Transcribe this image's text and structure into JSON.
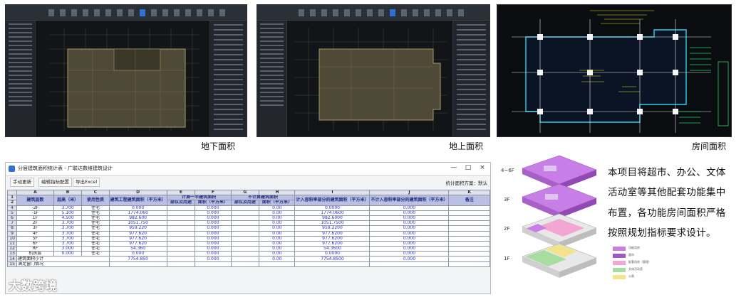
{
  "captions": {
    "basement": "地下面积",
    "above_ground": "地上面积",
    "room": "房间面积"
  },
  "window": {
    "title": "分层建筑面积统计表 - 广联达数维建筑设计",
    "minimize": "—",
    "maximize": "□",
    "close": "×"
  },
  "toolbar": {
    "manual_update": "手动更新",
    "edit_indicators": "编辑指标配置",
    "export_excel": "导出Excel",
    "right_text": "统计面积方案：默认"
  },
  "table": {
    "col_letters": [
      "A",
      "B",
      "C",
      "D",
      "E",
      "F",
      "G",
      "H",
      "I",
      "J",
      "K"
    ],
    "header_row1": {
      "floor": "建筑层数",
      "height": "层高（米）",
      "use": "使用性质",
      "total_area": "建筑工程建筑面积（平方米）",
      "full_calc": "计算一半建筑面积",
      "no_calc": "不计算建筑面积",
      "volume_area": "计入容积率部分的建筑面积（平方米）",
      "non_volume_area": "不计入容积率部分的建筑面积（平方米）",
      "note": "备注"
    },
    "header_row2": {
      "e": "部位及用途",
      "f": "面积（平方米）",
      "g": "部位及用途",
      "h": "面积（平方米）"
    },
    "rows": [
      {
        "n": "4",
        "floor": "-2F",
        "height": "3.700",
        "use": "住宅",
        "d": "0.000",
        "f": "0.000",
        "h": "0.00",
        "i": "0.0000",
        "j": "0.000"
      },
      {
        "n": "5",
        "floor": "-1F",
        "height": "5.100",
        "use": "住宅",
        "d": "1774.060",
        "f": "0.000",
        "h": "0.00",
        "i": "1774.0600",
        "j": "0.000"
      },
      {
        "n": "6",
        "floor": "1F",
        "height": "4.500",
        "use": "住宅",
        "d": "982.600",
        "f": "0.000",
        "h": "0.00",
        "i": "982.6000",
        "j": "0.000"
      },
      {
        "n": "7",
        "floor": "2F",
        "height": "3.700",
        "use": "住宅",
        "d": "1051.750",
        "f": "0.000",
        "h": "0.00",
        "i": "1051.7500",
        "j": "0.000"
      },
      {
        "n": "8",
        "floor": "3F",
        "height": "3.700",
        "use": "住宅",
        "d": "959.220",
        "f": "0.000",
        "h": "0.00",
        "i": "959.2200",
        "j": "0.000"
      },
      {
        "n": "9",
        "floor": "4F",
        "height": "3.700",
        "use": "住宅",
        "d": "977.620",
        "f": "0.000",
        "h": "0.00",
        "i": "977.6200",
        "j": "0.000"
      },
      {
        "n": "10",
        "floor": "5F",
        "height": "3.700",
        "use": "住宅",
        "d": "977.620",
        "f": "0.000",
        "h": "0.00",
        "i": "977.6200",
        "j": "0.000"
      },
      {
        "n": "11",
        "floor": "6F",
        "height": "3.700",
        "use": "住宅",
        "d": "977.620",
        "f": "0.000",
        "h": "0.00",
        "i": "977.6200",
        "j": "0.000"
      },
      {
        "n": "12",
        "floor": "RF",
        "height": "3.000",
        "use": "住宅",
        "d": "54.360",
        "f": "0.000",
        "h": "0.00",
        "i": "54.3600",
        "j": "0.000"
      },
      {
        "n": "13",
        "floor": "机房层",
        "height": "0.000",
        "use": "住宅",
        "d": "0.000",
        "f": "0.000",
        "h": "0.00",
        "i": "0.0000",
        "j": "0.000"
      }
    ],
    "subtotal": {
      "n": "14",
      "label": "建筑面积小计",
      "d": "7754.850",
      "f": "0.000",
      "h": "0.00",
      "i": "7754.8500",
      "j": "0.000"
    },
    "last_row": {
      "n": "15",
      "label": "满足窗门情况"
    },
    "row_nums_header": [
      "1",
      "2"
    ]
  },
  "floors": {
    "f46": "4~6F",
    "f3": "3F",
    "f2": "2F",
    "f1": "1F"
  },
  "legend": [
    "功能用房",
    "超市",
    "配套用房（管理）",
    "文体活动室",
    "公厕"
  ],
  "description": [
    "本项目将超市、办公、文体",
    "活动室等其他配套功能集中",
    "布置，各功能房间面积严格",
    "按照规划指标要求设计。"
  ],
  "watermark": "大数跨境",
  "colors": {
    "header_fill": "#b9c0e4",
    "number_blue": "#2b2fc8",
    "purple": "#c77ee6",
    "pink": "#f2a6d2",
    "green": "#a9dca0",
    "yellow": "#f3e38a"
  }
}
